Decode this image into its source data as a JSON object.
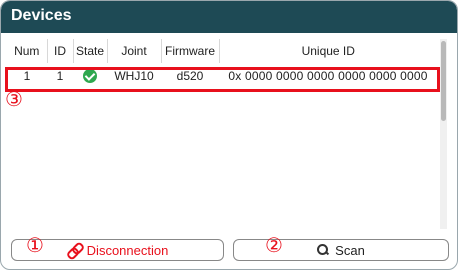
{
  "window": {
    "title": "Devices"
  },
  "table": {
    "columns": [
      "Num",
      "ID",
      "State",
      "Joint",
      "Firmware",
      "Unique ID"
    ],
    "rows": [
      {
        "num": "1",
        "id": "1",
        "state": "connected-check-icon",
        "joint": "WHJ10",
        "firmware": "d520",
        "unique_id": "0x 0000 0000 0000 0000 0000 0000"
      }
    ]
  },
  "buttons": {
    "disconnect_label": "Disconnection",
    "scan_label": "Scan"
  },
  "annotations": {
    "marker_1": "①",
    "marker_2": "②",
    "marker_3": "③"
  },
  "colors": {
    "header_bg": "#1e4a55",
    "highlight": "#e8101c",
    "state_ok": "#2fa84f"
  }
}
